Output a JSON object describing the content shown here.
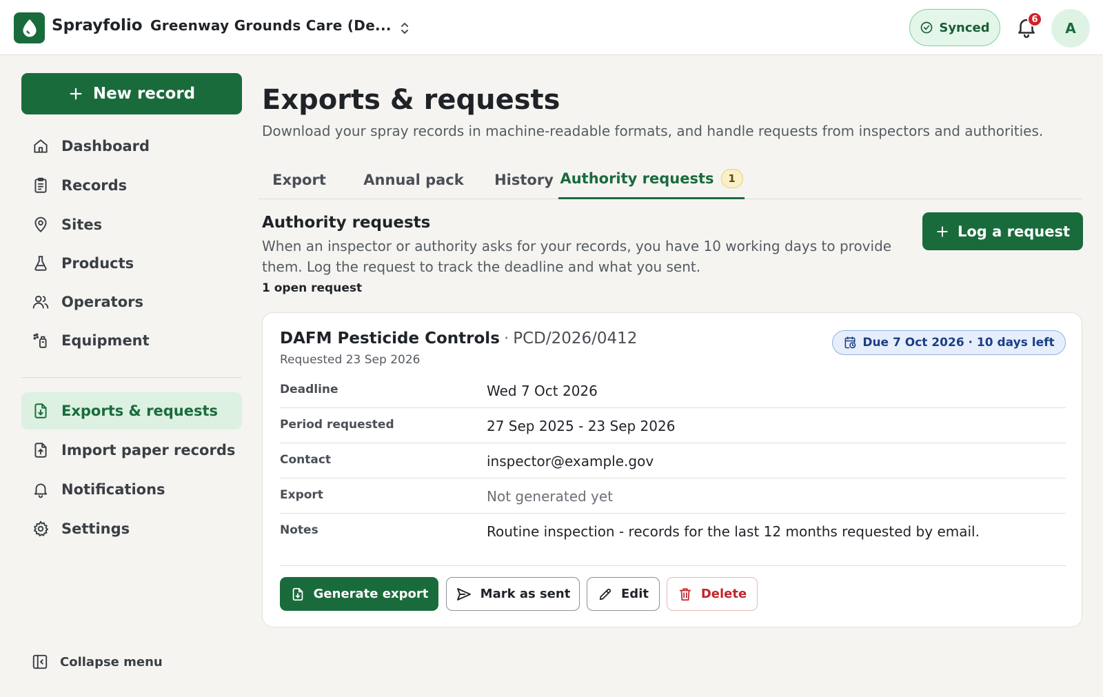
{
  "header": {
    "brand": "Sprayfolio",
    "org_name": "Greenway Grounds Care (De...",
    "sync_status": "Synced",
    "notification_count": "6",
    "avatar_initial": "A"
  },
  "sidebar": {
    "new_record_label": "New record",
    "items": [
      {
        "label": "Dashboard",
        "icon": "home-icon"
      },
      {
        "label": "Records",
        "icon": "clipboard-icon"
      },
      {
        "label": "Sites",
        "icon": "map-pin-icon"
      },
      {
        "label": "Products",
        "icon": "flask-icon"
      },
      {
        "label": "Operators",
        "icon": "users-icon"
      },
      {
        "label": "Equipment",
        "icon": "sprayer-icon"
      },
      {
        "label": "Exports & requests",
        "icon": "file-download-icon",
        "active": true
      },
      {
        "label": "Import paper records",
        "icon": "file-upload-icon"
      },
      {
        "label": "Notifications",
        "icon": "bell-icon"
      },
      {
        "label": "Settings",
        "icon": "gear-icon"
      }
    ],
    "collapse_label": "Collapse menu"
  },
  "main": {
    "title": "Exports & requests",
    "subtitle": "Download your spray records in machine-readable formats, and handle requests from inspectors and authorities.",
    "tabs": [
      {
        "label": "Export"
      },
      {
        "label": "Annual pack"
      },
      {
        "label": "History"
      },
      {
        "label": "Authority requests",
        "count": "1",
        "active": true
      }
    ],
    "section": {
      "title": "Authority requests",
      "description": "When an inspector or authority asks for your records, you have 10 working days to provide them. Log the request to track the deadline and what you sent.",
      "open_count": "1 open request",
      "log_button": "Log a request"
    },
    "request": {
      "authority": "DAFM Pesticide Controls",
      "separator": "·",
      "reference": "PCD/2026/0412",
      "requested": "Requested 23 Sep 2026",
      "due_badge": "Due 7 Oct 2026 · 10 days left",
      "fields": [
        {
          "label": "Deadline",
          "value": "Wed 7 Oct 2026"
        },
        {
          "label": "Period requested",
          "value": "27 Sep 2025 - 23 Sep 2026"
        },
        {
          "label": "Contact",
          "value": "inspector@example.gov"
        },
        {
          "label": "Export",
          "value": "Not generated yet"
        },
        {
          "label": "Notes",
          "value": "Routine inspection - records for the last 12 months requested by email."
        }
      ],
      "actions": {
        "generate": "Generate export",
        "mark_sent": "Mark as sent",
        "edit": "Edit",
        "delete": "Delete"
      }
    }
  },
  "colors": {
    "brand_green": "#1a6b3c",
    "active_nav_bg": "#dcf1e1",
    "due_badge_bg": "#e6eefb",
    "danger": "#c0242b",
    "badge_red": "#d32027"
  }
}
